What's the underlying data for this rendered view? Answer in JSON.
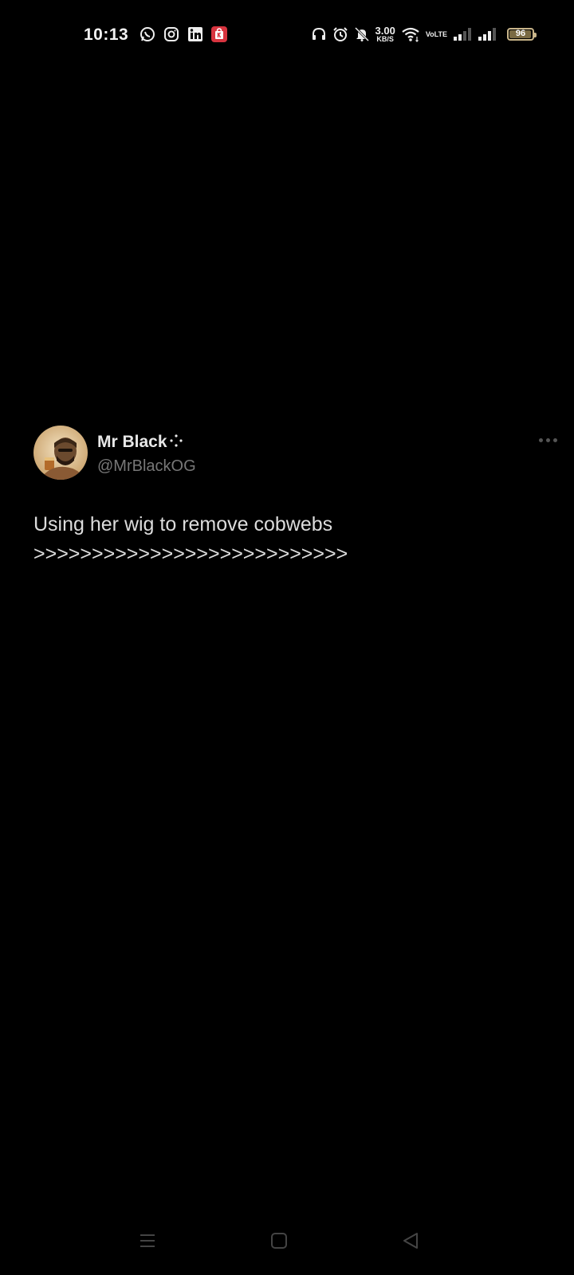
{
  "status_bar": {
    "time": "10:13",
    "app_icons": [
      "whatsapp-icon",
      "instagram-icon",
      "linkedin-icon",
      "shop-app-icon"
    ],
    "net_speed_value": "3.00",
    "net_speed_unit": "KB/S",
    "volte_line1": "Vo",
    "volte_line2": "LTE",
    "battery_level": "96"
  },
  "tweet": {
    "display_name": "Mr Black",
    "handle": "@MrBlackOG",
    "text": "Using her wig to remove cobwebs\n>>>>>>>>>>>>>>>>>>>>>>>>>>>"
  },
  "nav_bar": {
    "icons": [
      "menu-icon",
      "home-icon",
      "back-icon"
    ]
  },
  "colors": {
    "background": "#000000",
    "text": "#dcdcdc",
    "handle": "#777777",
    "battery_frame": "#c9b58a"
  }
}
